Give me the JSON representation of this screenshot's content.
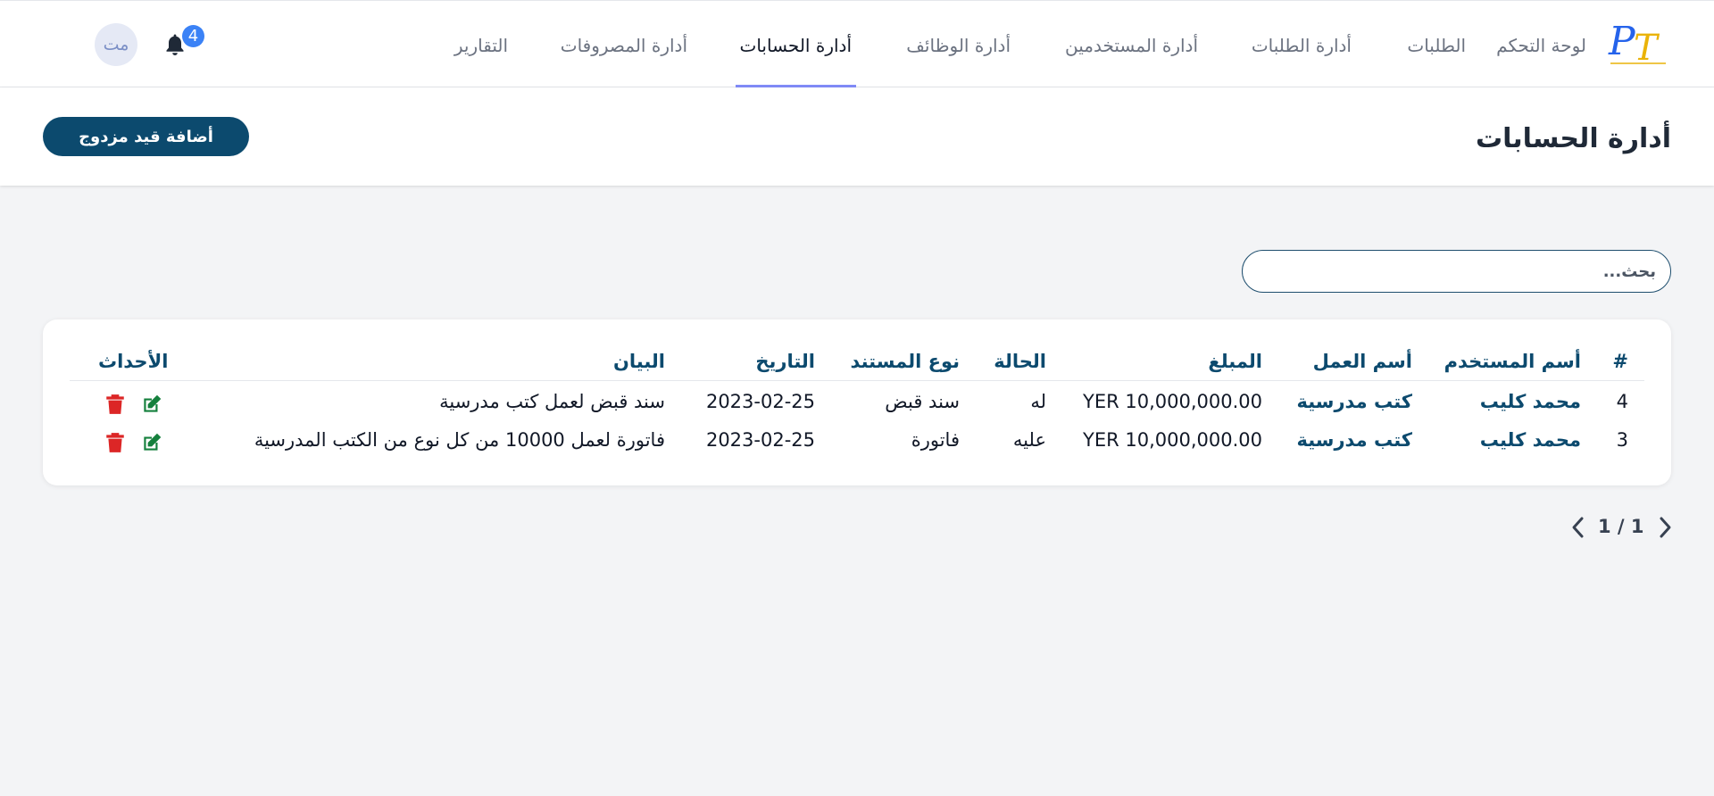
{
  "nav": {
    "logo_text": "PT",
    "items": [
      {
        "label": "لوحة التحكم"
      },
      {
        "label": "الطلبات"
      },
      {
        "label": "أدارة الطلبات"
      },
      {
        "label": "أدارة المستخدمين"
      },
      {
        "label": "أدارة الوظائف"
      },
      {
        "label": "أدارة الحسابات",
        "active": true
      },
      {
        "label": "أدارة المصروفات"
      },
      {
        "label": "التقارير"
      }
    ],
    "notifications_count": "4",
    "avatar_initials": "مت"
  },
  "header": {
    "title": "أدارة الحسابات",
    "add_button": "أضافة قيد مزدوج"
  },
  "search": {
    "placeholder": "بحث..."
  },
  "table": {
    "columns": [
      "#",
      "أسم المستخدم",
      "أسم العمل",
      "المبلغ",
      "الحالة",
      "نوع المستند",
      "التاريخ",
      "البيان",
      "الأحداث"
    ],
    "rows": [
      {
        "id": "4",
        "user": "محمد كليب",
        "work": "كتب مدرسية",
        "amount": "YER 10,000,000.00",
        "status": "له",
        "doc_type": "سند قبض",
        "date": "2023-02-25",
        "description": "سند قبض لعمل كتب مدرسية"
      },
      {
        "id": "3",
        "user": "محمد كليب",
        "work": "كتب مدرسية",
        "amount": "YER 10,000,000.00",
        "status": "عليه",
        "doc_type": "فاتورة",
        "date": "2023-02-25",
        "description": "فاتورة لعمل 10000 من كل نوع من الكتب المدرسية"
      }
    ]
  },
  "pagination": {
    "text": "1 / 1"
  },
  "colors": {
    "primary": "#0c4a6e",
    "active_tab_underline": "#818cf8",
    "badge": "#3b82f6",
    "edit_icon": "#15803d",
    "delete_icon": "#dc2626"
  }
}
